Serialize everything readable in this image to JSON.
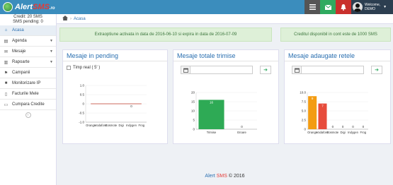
{
  "header": {
    "logo_text_main": "Alert",
    "logo_text_sms": "SMS",
    "logo_text_tld": ".ro",
    "icons": [
      "list-icon",
      "envelope-icon",
      "bell-icon"
    ],
    "user": {
      "greeting": "Welcome,",
      "name": "DEMO"
    }
  },
  "sidebar": {
    "credit_line": "Credit: 20 SMS",
    "pending_line": "SMS pending: 0",
    "items": [
      {
        "label": "Acasa",
        "icon": "home-icon",
        "active": true,
        "caret": false
      },
      {
        "label": "Agenda",
        "icon": "book-icon",
        "active": false,
        "caret": true
      },
      {
        "label": "Mesaje",
        "icon": "inbox-icon",
        "active": false,
        "caret": true
      },
      {
        "label": "Rapoarte",
        "icon": "chart-icon",
        "active": false,
        "caret": true
      },
      {
        "label": "Campanii",
        "icon": "flag-icon",
        "active": false,
        "caret": false
      },
      {
        "label": "Monitorizare IP",
        "icon": "video-icon",
        "active": false,
        "caret": false
      },
      {
        "label": "Facturile Mele",
        "icon": "document-icon",
        "active": false,
        "caret": false
      },
      {
        "label": "Cumpara Credite",
        "icon": "credit-card-icon",
        "active": false,
        "caret": false
      }
    ]
  },
  "breadcrumb": {
    "label": "Acasa"
  },
  "alerts": {
    "extra": "Extraoptiune activata in data de 2016-06-10 si expira in data de 2016-07-09",
    "credit": "Creditul disponibil in cont este de 1000 SMS"
  },
  "panels": {
    "pending": {
      "title": "Mesaje in pending",
      "realtime_label": "Timp real ( 5' )"
    },
    "totals": {
      "title": "Mesaje totale trimise",
      "date_value": "",
      "go_icon": "arrow-right-icon"
    },
    "networks": {
      "title": "Mesaje adaugate retele",
      "date_value": "",
      "go_icon": "arrow-right-icon"
    }
  },
  "chart_data": [
    {
      "type": "line",
      "categories": [
        "Orange",
        "Vodafone",
        "Cosmote",
        "Digi",
        "Indygen",
        "Frog"
      ],
      "series": [
        {
          "values": [
            0,
            0,
            0,
            0,
            0,
            0
          ]
        }
      ],
      "data_labels": [
        "0"
      ],
      "ylim": [
        -1.0,
        1.0
      ],
      "yticks": [
        "1.0",
        "0.5",
        "0",
        "-0.5",
        "-1.0"
      ],
      "colors": [
        "#c0392b"
      ]
    },
    {
      "type": "bar",
      "categories": [
        "Trimise",
        "Eroare"
      ],
      "values": [
        16,
        0
      ],
      "data_labels": [
        "16",
        "0"
      ],
      "ylim": [
        0,
        20
      ],
      "yticks": [
        "20",
        "15",
        "10",
        "5",
        "0"
      ],
      "colors": [
        "#2eaa55",
        "#2eaa55"
      ]
    },
    {
      "type": "bar",
      "categories": [
        "Orange",
        "Vodafone",
        "Cosmote",
        "Digi",
        "Indygen",
        "Frog"
      ],
      "values": [
        9,
        7,
        0,
        0,
        0,
        0
      ],
      "data_labels": [
        "9",
        "7",
        "0",
        "0",
        "0",
        "0"
      ],
      "ylim": [
        0,
        10
      ],
      "yticks": [
        "10.0",
        "7.5",
        "5.0",
        "2.5",
        "0"
      ],
      "colors": [
        "#f39c12",
        "#e74c3c",
        "#95a5a6",
        "#95a5a6",
        "#95a5a6",
        "#95a5a6"
      ]
    }
  ],
  "footer": {
    "brand_a": "Alert",
    "brand_s": "SMS",
    "copyright": "© 2016"
  }
}
